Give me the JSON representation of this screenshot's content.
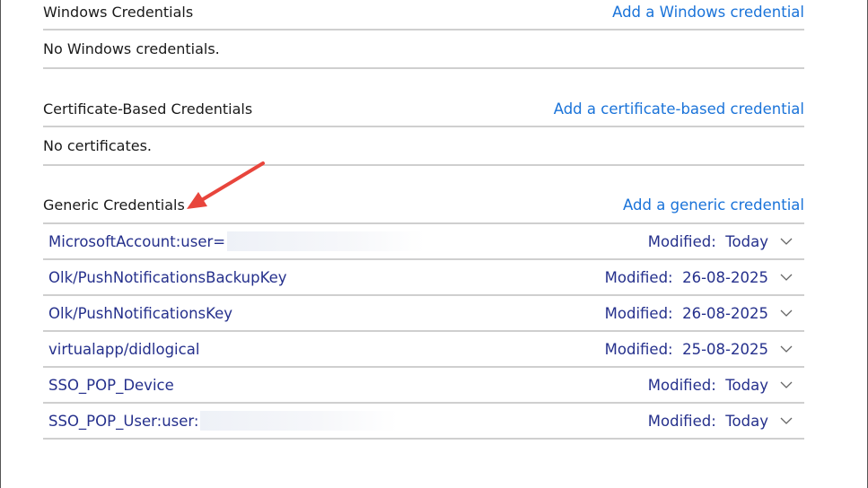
{
  "windows": {
    "title": "Windows Credentials",
    "add_link": "Add a Windows credential",
    "empty": "No Windows credentials."
  },
  "certificate": {
    "title": "Certificate-Based Credentials",
    "add_link": "Add a certificate-based credential",
    "empty": "No certificates."
  },
  "generic": {
    "title": "Generic Credentials",
    "add_link": "Add a generic credential",
    "modified_label": "Modified:",
    "items": [
      {
        "name": "MicrosoftAccount:user=",
        "modified": "Today",
        "redacted": true
      },
      {
        "name": "Olk/PushNotificationsBackupKey",
        "modified": "26-08-2025"
      },
      {
        "name": "Olk/PushNotificationsKey",
        "modified": "26-08-2025"
      },
      {
        "name": "virtualapp/didlogical",
        "modified": "25-08-2025"
      },
      {
        "name": "SSO_POP_Device",
        "modified": "Today"
      },
      {
        "name": "SSO_POP_User:user:",
        "modified": "Today",
        "redacted": true
      }
    ]
  },
  "colors": {
    "link": "#1a73d9",
    "item_text": "#25308c",
    "arrow": "#e8453c",
    "divider": "#cfcfcf"
  }
}
